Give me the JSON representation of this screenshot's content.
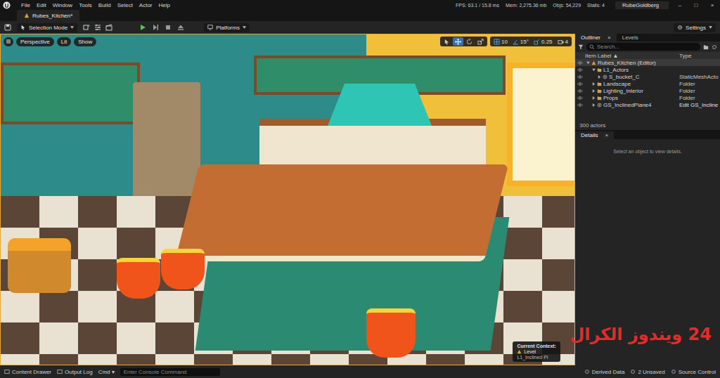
{
  "menu": [
    "File",
    "Edit",
    "Window",
    "Tools",
    "Build",
    "Select",
    "Actor",
    "Help"
  ],
  "stats": [
    "FPS: 63.1 / 15.8 ms",
    "Mem: 2,275.36 mb",
    "Objs: 54,229",
    "Stalls: 4"
  ],
  "project": "RubeGoldberg",
  "window_controls": [
    "–",
    "□",
    "×"
  ],
  "document_tab": {
    "label": "Rubes_Kitchen*",
    "selected": true
  },
  "toolbar": {
    "mode": "Selection Mode",
    "play_controls": [
      {
        "kind": "play"
      },
      {
        "kind": "step"
      },
      {
        "kind": "stop"
      },
      {
        "kind": "eject"
      }
    ],
    "platforms": "Platforms",
    "settings": "Settings"
  },
  "viewport": {
    "buttons": [
      "Perspective",
      "Lit",
      "Show"
    ],
    "tools": [
      {
        "kind": "select",
        "selected": false
      },
      {
        "kind": "move",
        "selected": true
      },
      {
        "kind": "rotate",
        "selected": false
      },
      {
        "kind": "scale",
        "selected": false
      }
    ],
    "snaps": [
      {
        "kind": "grid",
        "value": "10",
        "on": true
      },
      {
        "kind": "angle",
        "value": "15°",
        "on": true
      },
      {
        "kind": "scale",
        "value": "0.25",
        "on": true
      },
      {
        "kind": "camera",
        "value": "4",
        "on": false
      }
    ],
    "context": {
      "title": "Current Context:",
      "level": "Level",
      "name": "L1_Inclined Pl"
    }
  },
  "outliner": {
    "tabs": [
      {
        "label": "Outliner",
        "close": "×",
        "selected": true
      },
      {
        "label": "Levels",
        "close": "",
        "selected": false
      }
    ],
    "search": {
      "placeholder": "Search..."
    },
    "columns": [
      "Item Label ▲",
      "Type"
    ],
    "rows": [
      {
        "label": "Rubes_Kitchen (Editor)",
        "type": "",
        "depth": 0,
        "expanded": true,
        "kind": "level",
        "selected": true
      },
      {
        "label": "L1_Actors",
        "type": "",
        "depth": 1,
        "expanded": true,
        "kind": "folder",
        "selected": false
      },
      {
        "label": "S_bucket_C",
        "type": "StaticMeshActo",
        "depth": 2,
        "expanded": false,
        "kind": "actor",
        "selected": false
      },
      {
        "label": "Landscape",
        "type": "Folder",
        "depth": 1,
        "expanded": false,
        "kind": "folder",
        "selected": false
      },
      {
        "label": "Lighting_interior",
        "type": "Folder",
        "depth": 1,
        "expanded": false,
        "kind": "folder",
        "selected": false
      },
      {
        "label": "Props",
        "type": "Folder",
        "depth": 1,
        "expanded": false,
        "kind": "folder",
        "selected": false
      },
      {
        "label": "GS_InclinedPlane4",
        "type": "Edit GS_Incline",
        "depth": 1,
        "expanded": false,
        "kind": "actor",
        "selected": false
      }
    ],
    "count": "300 actors"
  },
  "details": {
    "title": "Details",
    "close": "×",
    "empty": "Select an object to view details."
  },
  "status_bar": {
    "left": [
      "Content Drawer",
      "Output Log"
    ],
    "cmd": "Cmd ▾",
    "console_placeholder": "Enter Console Command",
    "right": [
      "Derived Data",
      "2 Unsaved",
      "Source Control"
    ]
  },
  "watermark": "24 ويندوز الكرال"
}
